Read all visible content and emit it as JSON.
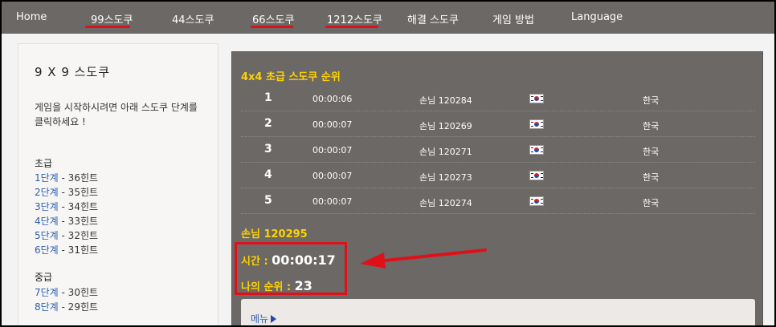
{
  "nav": {
    "items": [
      "Home",
      "99스도쿠",
      "44스도쿠",
      "66스도쿠",
      "1212스도쿠",
      "해결 스도쿠",
      "게임 방법",
      "Language"
    ]
  },
  "sidebar": {
    "title": "9 X 9 스도쿠",
    "description": "게임을 시작하시려면 아래 스도쿠 단계를 클릭하세요 !",
    "groups": [
      {
        "label": "초급",
        "levels": [
          {
            "link": "1단계",
            "hint": " - 36힌트"
          },
          {
            "link": "2단계",
            "hint": " - 35힌트"
          },
          {
            "link": "3단계",
            "hint": " - 34힌트"
          },
          {
            "link": "4단계",
            "hint": " - 33힌트"
          },
          {
            "link": "5단계",
            "hint": " - 32힌트"
          },
          {
            "link": "6단계",
            "hint": " - 31힌트"
          }
        ]
      },
      {
        "label": "중급",
        "levels": [
          {
            "link": "7단계",
            "hint": " - 30힌트"
          },
          {
            "link": "8단계",
            "hint": " - 29힌트"
          }
        ]
      }
    ]
  },
  "ranking": {
    "title": "4x4 초급 스도쿠 순위",
    "rows": [
      {
        "rank": "1",
        "time": "00:00:06",
        "name": "손님 120284",
        "country": "한국"
      },
      {
        "rank": "2",
        "time": "00:00:07",
        "name": "손님 120269",
        "country": "한국"
      },
      {
        "rank": "3",
        "time": "00:00:07",
        "name": "손님 120271",
        "country": "한국"
      },
      {
        "rank": "4",
        "time": "00:00:07",
        "name": "손님 120273",
        "country": "한국"
      },
      {
        "rank": "5",
        "time": "00:00:07",
        "name": "손님 120274",
        "country": "한국"
      }
    ]
  },
  "me": {
    "name": "손님 120295",
    "time_label": "시간 : ",
    "time_value": "00:00:17",
    "rank_label": "나의 순위 : ",
    "rank_value": "23"
  },
  "menu": {
    "label": "메뉴"
  },
  "colors": {
    "accent": "#ffd200",
    "annotation": "#e0101a",
    "panel": "#6b6865",
    "link": "#2a5db0"
  }
}
